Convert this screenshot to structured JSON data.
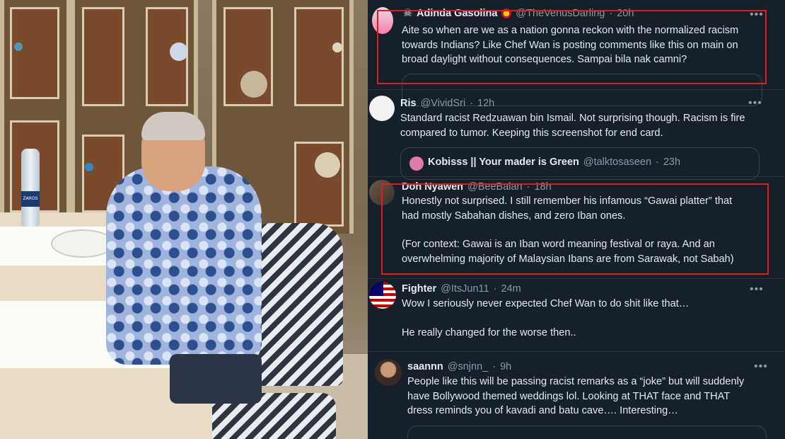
{
  "photo": {
    "bottle_label": "ZAROS"
  },
  "tweets": [
    {
      "name": "Adinda Gasolina",
      "handle": "@TheVenusDarling",
      "time": "20h",
      "badge": "flag-icon",
      "lines": [
        "Aite so when are we as a nation gonna reckon with the normalized racism",
        "towards Indians? Like Chef Wan is posting comments like this on main on",
        "broad daylight without consequences. Sampai bila nak camni?"
      ]
    },
    {
      "name": "Ris",
      "handle": "@VividSri",
      "time": "12h",
      "lines": [
        "Standard racist Redzuawan bin Ismail. Not surprising though. Racism is fire",
        "compared to tumor. Keeping this screenshot for end card."
      ],
      "quote": {
        "name": "Kobisss || Your mader is Green",
        "handle": "@talktosaseen",
        "time": "23h"
      }
    },
    {
      "name": "Doh Nyawen",
      "handle": "@BeeBalan",
      "time": "18h",
      "lines": [
        "Honestly not surprised. I still remember his infamous “Gawai platter” that",
        "had mostly Sabahan dishes, and zero Iban ones.",
        "",
        "(For context: Gawai is an Iban word meaning festival or raya. And an",
        "overwhelming majority of Malaysian Ibans are from Sarawak, not Sabah)"
      ]
    },
    {
      "name": "Fighter",
      "handle": "@ItsJun11",
      "time": "24m",
      "lines": [
        "Wow I seriously never expected Chef Wan to do shit like that…",
        "",
        "He really changed for the worse then.."
      ]
    },
    {
      "name": "saannn",
      "handle": "@snjnn_",
      "time": "9h",
      "lines": [
        "People like this will be passing racist remarks as a “joke” but will suddenly",
        "have Bollywood themed weddings lol. Looking at THAT face and THAT",
        "dress reminds you of kavadi and batu cave…. Interesting…"
      ]
    }
  ],
  "separator": "·",
  "more": "•••",
  "colors": {
    "background": "#15202b",
    "highlight": "#e21b1b",
    "text": "#e7e9ea",
    "muted": "#8b98a5"
  }
}
